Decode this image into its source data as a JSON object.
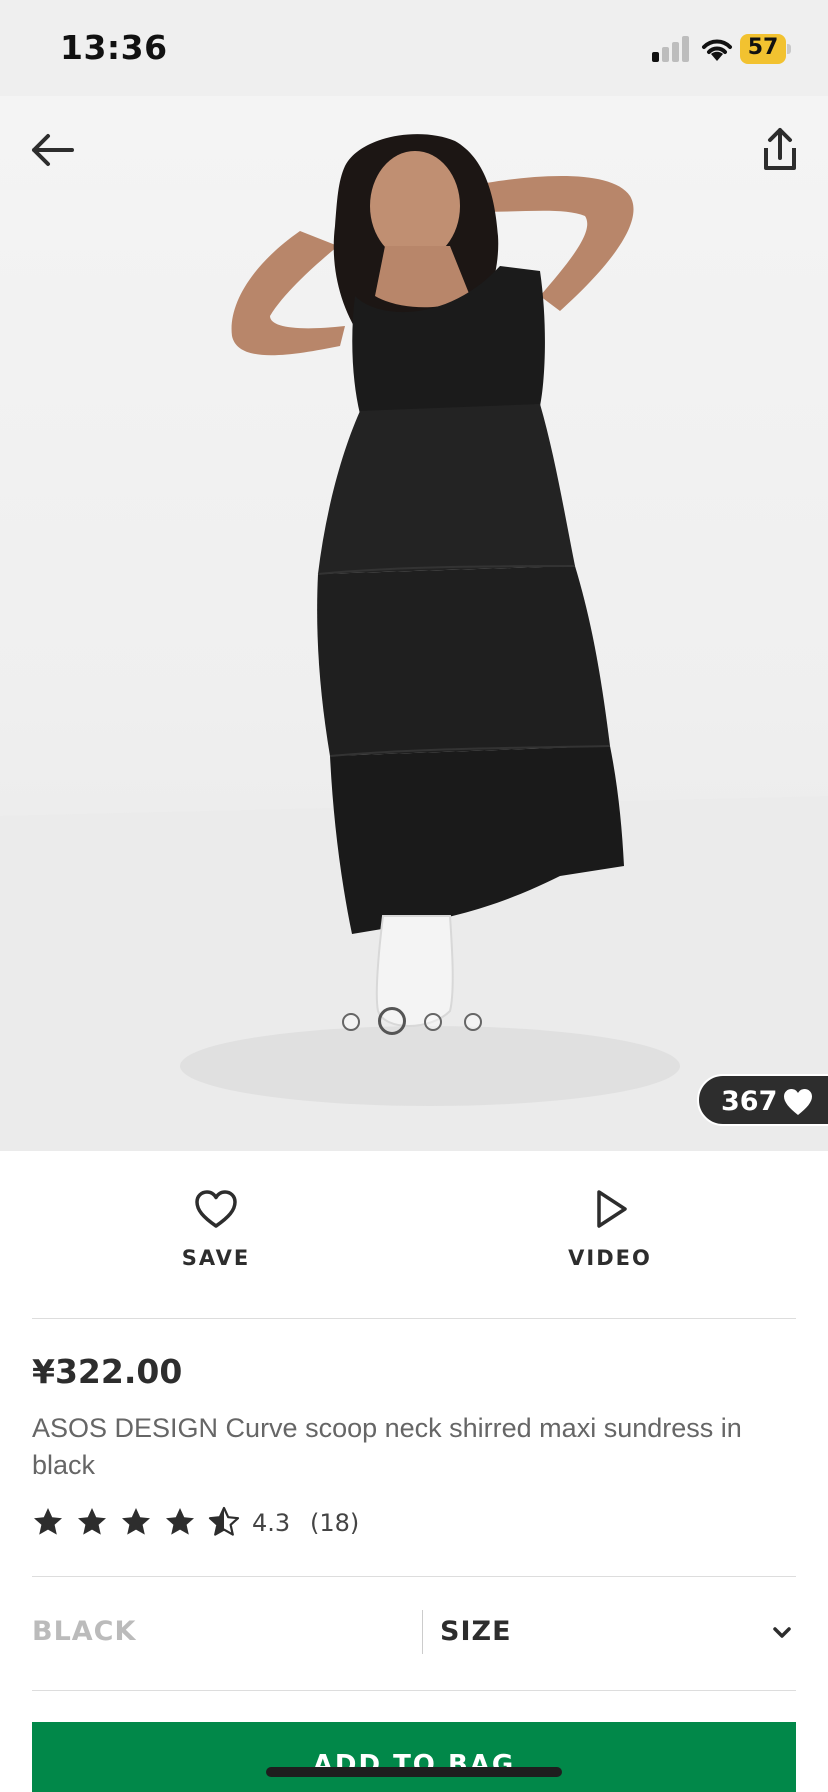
{
  "status_bar": {
    "time": "13:36",
    "battery": "57",
    "battery_color": "#f2c230",
    "icons": [
      "signal-icon",
      "wifi-icon",
      "battery-icon"
    ]
  },
  "hero": {
    "icons": [
      "back-arrow-icon",
      "share-icon"
    ],
    "carousel": {
      "count": 4,
      "active_index": 1
    },
    "saves_count": "367"
  },
  "actions": {
    "save_label": "SAVE",
    "video_label": "VIDEO",
    "icons": [
      "heart-outline-icon",
      "play-outline-icon"
    ]
  },
  "product": {
    "price": "¥322.00",
    "name": "ASOS DESIGN Curve scoop neck shirred maxi sundress in black",
    "rating": {
      "stars": 4.3,
      "value": "4.3",
      "count": "(18)"
    }
  },
  "selectors": {
    "colour": "BLACK",
    "size": "SIZE"
  },
  "cta": {
    "label": "ADD TO BAG",
    "color": "#018849"
  }
}
